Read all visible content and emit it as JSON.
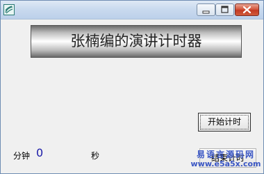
{
  "window": {
    "title": "",
    "controls": [
      "minimize-icon",
      "maximize-icon",
      "close-icon"
    ]
  },
  "banner": {
    "title": "张楠编的演讲计时器"
  },
  "buttons": {
    "start_label": "开始计时",
    "end_label": "结束计时"
  },
  "timer": {
    "minutes_label": "分钟",
    "minutes_value": "0",
    "seconds_label": "秒"
  },
  "watermark": {
    "line1": "易语言源码网",
    "line2": "www.e5a5x.com"
  },
  "colors": {
    "window_bg": "#f0f0f0",
    "minutes_value": "#1a1aa8",
    "watermark": "#3a56c4",
    "close_button": "#c23a23"
  }
}
